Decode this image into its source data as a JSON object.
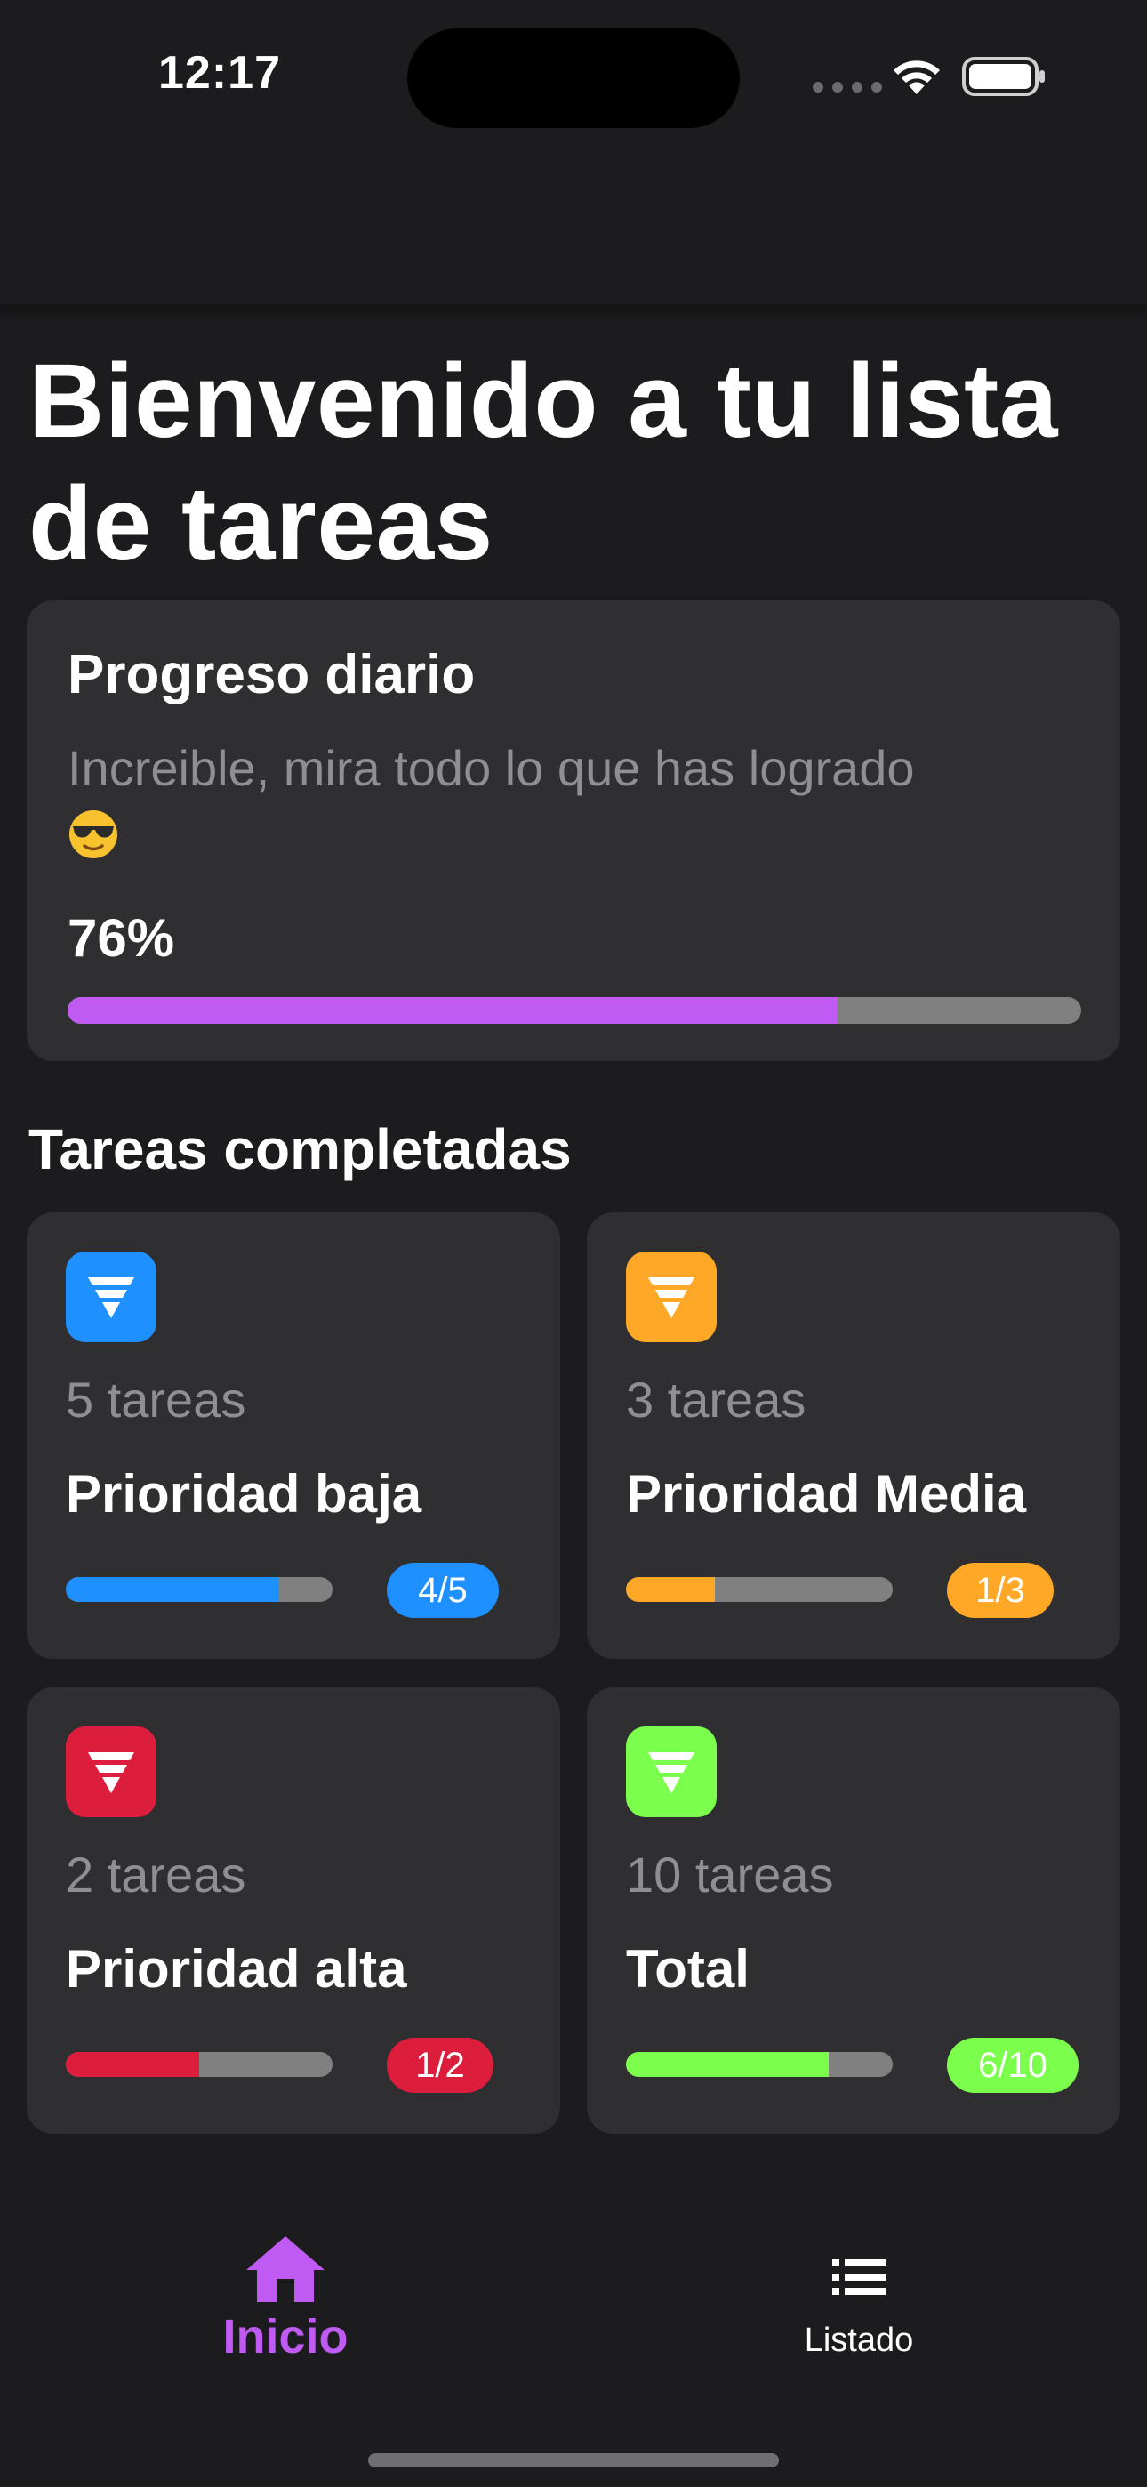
{
  "status_bar": {
    "time": "12:17"
  },
  "main": {
    "title": "Bienvenido a tu lista de tareas",
    "progress_card": {
      "title": "Progreso diario",
      "subtitle": "Increible, mira todo lo que has logrado",
      "emoji": "smiling-face-with-sunglasses",
      "percent_text": "76%",
      "progress_fraction": 0.76,
      "bar_color": "#bf5af2"
    },
    "section_title": "Tareas completadas",
    "stats": [
      {
        "count": "5 tareas",
        "label": "Prioridad baja",
        "badge": "4/5",
        "fraction": 0.8,
        "color": "#1e90ff",
        "icon": "funnel-icon"
      },
      {
        "count": "3 tareas",
        "label": "Prioridad Media",
        "badge": "1/3",
        "fraction": 0.333,
        "color": "#ffa726",
        "icon": "funnel-icon"
      },
      {
        "count": "2 tareas",
        "label": "Prioridad alta",
        "badge": "1/2",
        "fraction": 0.5,
        "color": "#dc1e3c",
        "icon": "funnel-icon"
      },
      {
        "count": "10 tareas",
        "label": "Total",
        "badge": "6/10",
        "fraction": 0.76,
        "color": "#7cff4c",
        "icon": "funnel-icon"
      }
    ]
  },
  "bottom_nav": {
    "items": [
      {
        "label": "Inicio",
        "icon": "home-icon",
        "active": true
      },
      {
        "label": "Listado",
        "icon": "list-icon",
        "active": false
      }
    ],
    "active_color": "#bf5af2"
  }
}
